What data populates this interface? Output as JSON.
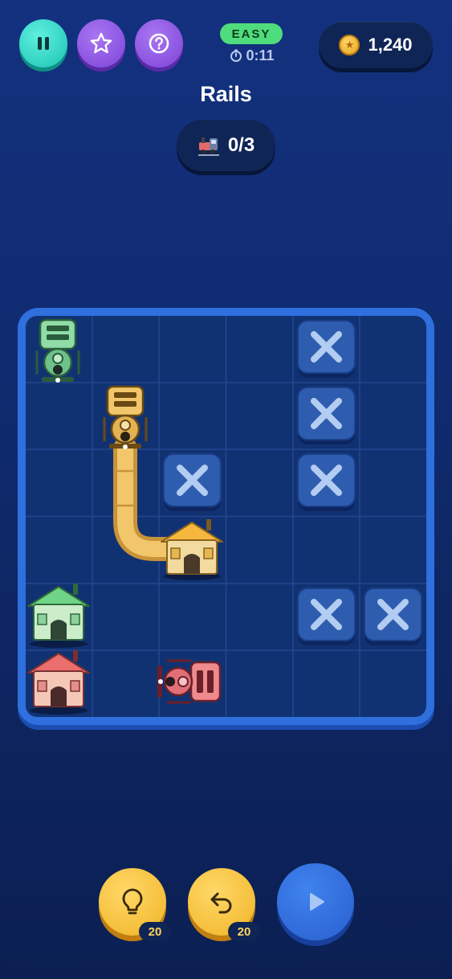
{
  "header": {
    "difficulty": "EASY",
    "timer": "0:11",
    "coins": "1,240",
    "title": "Rails",
    "progress": "0/3"
  },
  "controls": {
    "hint_count": "20",
    "undo_count": "20"
  },
  "colors": {
    "teal": "#1bc3b3",
    "purple": "#7d43d8",
    "easy_green": "#4fdc7c",
    "gold": "#f0b325",
    "board_border": "#2f6fde",
    "board_fill": "#113272",
    "train_green": "#7ecf9a",
    "train_yellow": "#f2c66b",
    "train_red": "#ef8a8f"
  },
  "board": {
    "rows": 6,
    "cols": 6,
    "blocked_cells": [
      [
        0,
        4
      ],
      [
        1,
        4
      ],
      [
        2,
        2
      ],
      [
        2,
        4
      ],
      [
        4,
        4
      ],
      [
        4,
        5
      ]
    ],
    "houses": [
      {
        "color": "yellow",
        "row": 3,
        "col": 2
      },
      {
        "color": "green",
        "row": 4,
        "col": 0
      },
      {
        "color": "red",
        "row": 5,
        "col": 0
      }
    ],
    "trains": [
      {
        "color": "green",
        "row": 0,
        "col": 0,
        "facing": "down"
      },
      {
        "color": "yellow",
        "row": 1,
        "col": 1,
        "facing": "down"
      },
      {
        "color": "red",
        "row": 5,
        "col": 2,
        "facing": "left"
      }
    ],
    "track": {
      "color": "yellow",
      "path": [
        [
          1,
          1
        ],
        [
          2,
          1
        ],
        [
          3,
          1
        ],
        [
          3,
          2
        ]
      ]
    }
  },
  "icons": {
    "pause": "pause-icon",
    "star": "star-icon",
    "help": "question-icon",
    "timer": "stopwatch-icon",
    "coin": "coin-icon",
    "train": "train-icon",
    "hint": "lightbulb-icon",
    "undo": "undo-icon",
    "play": "play-icon",
    "blocked": "x-icon",
    "house": "house-icon"
  }
}
